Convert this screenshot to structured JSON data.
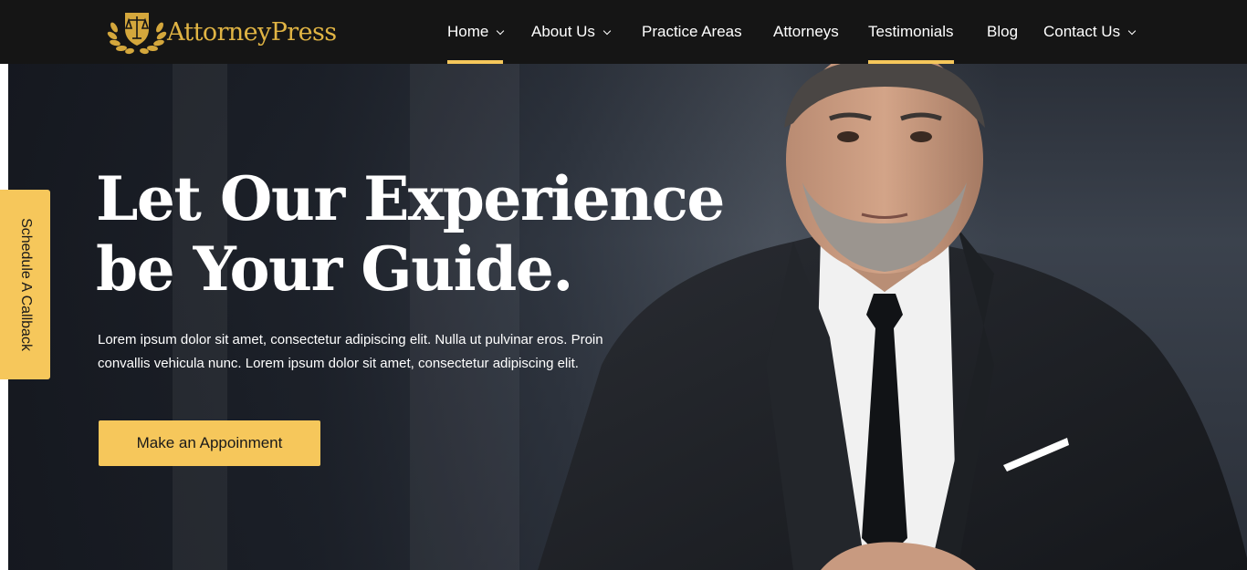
{
  "brand": {
    "name": "AttorneyPress",
    "logo_icon": "scales-laurel-icon",
    "color": "#e0b444"
  },
  "nav": {
    "items": [
      {
        "label": "Home",
        "has_dropdown": true,
        "active": true
      },
      {
        "label": "About Us",
        "has_dropdown": true,
        "active": false
      },
      {
        "label": "Practice Areas",
        "has_dropdown": false,
        "active": false
      },
      {
        "label": "Attorneys",
        "has_dropdown": false,
        "active": false
      },
      {
        "label": "Testimonials",
        "has_dropdown": false,
        "active": true
      },
      {
        "label": "Blog",
        "has_dropdown": false,
        "active": false
      },
      {
        "label": "Contact Us",
        "has_dropdown": true,
        "active": false
      }
    ],
    "active_underline_color": "#f6c75b"
  },
  "hero": {
    "title_line1": "Let Our Experience",
    "title_line2": "be Your Guide.",
    "text": "Lorem ipsum dolor sit amet, consectetur adipiscing elit. Nulla ut pulvinar eros. Proin convallis vehicula nunc. Lorem ipsum dolor sit amet, consectetur adipiscing elit.",
    "cta_label": "Make an Appoinment"
  },
  "side_tab": {
    "label": "Schedule A Callback"
  },
  "colors": {
    "header_bg": "#151515",
    "accent": "#f6c75b"
  }
}
